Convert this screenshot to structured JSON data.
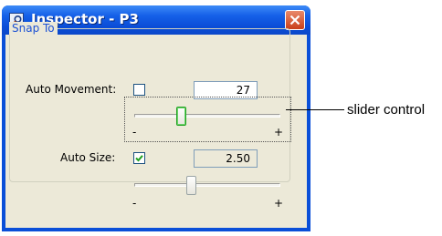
{
  "window": {
    "title": "Inspector - P3",
    "icon": "inspector-app-icon",
    "close_icon": "close-icon"
  },
  "snap_to": {
    "group_title": "Snap To",
    "auto_movement": {
      "label": "Auto Movement:",
      "checked": false,
      "value": "27",
      "slider_min_label": "-",
      "slider_max_label": "+",
      "slider_level": 0.31
    },
    "auto_size": {
      "label": "Auto Size:",
      "checked": true,
      "value": "2.50",
      "slider_min_label": "-",
      "slider_max_label": "+",
      "slider_level": 0.38
    }
  },
  "annotation": {
    "text": "slider control"
  },
  "colors": {
    "titlebar": "#0a4cd6",
    "close_button": "#c93f1a",
    "dialog_background": "#ece9d8",
    "group_title": "#1c51d4",
    "focus_thumb": "#21a121",
    "checkmark": "#21a121"
  }
}
